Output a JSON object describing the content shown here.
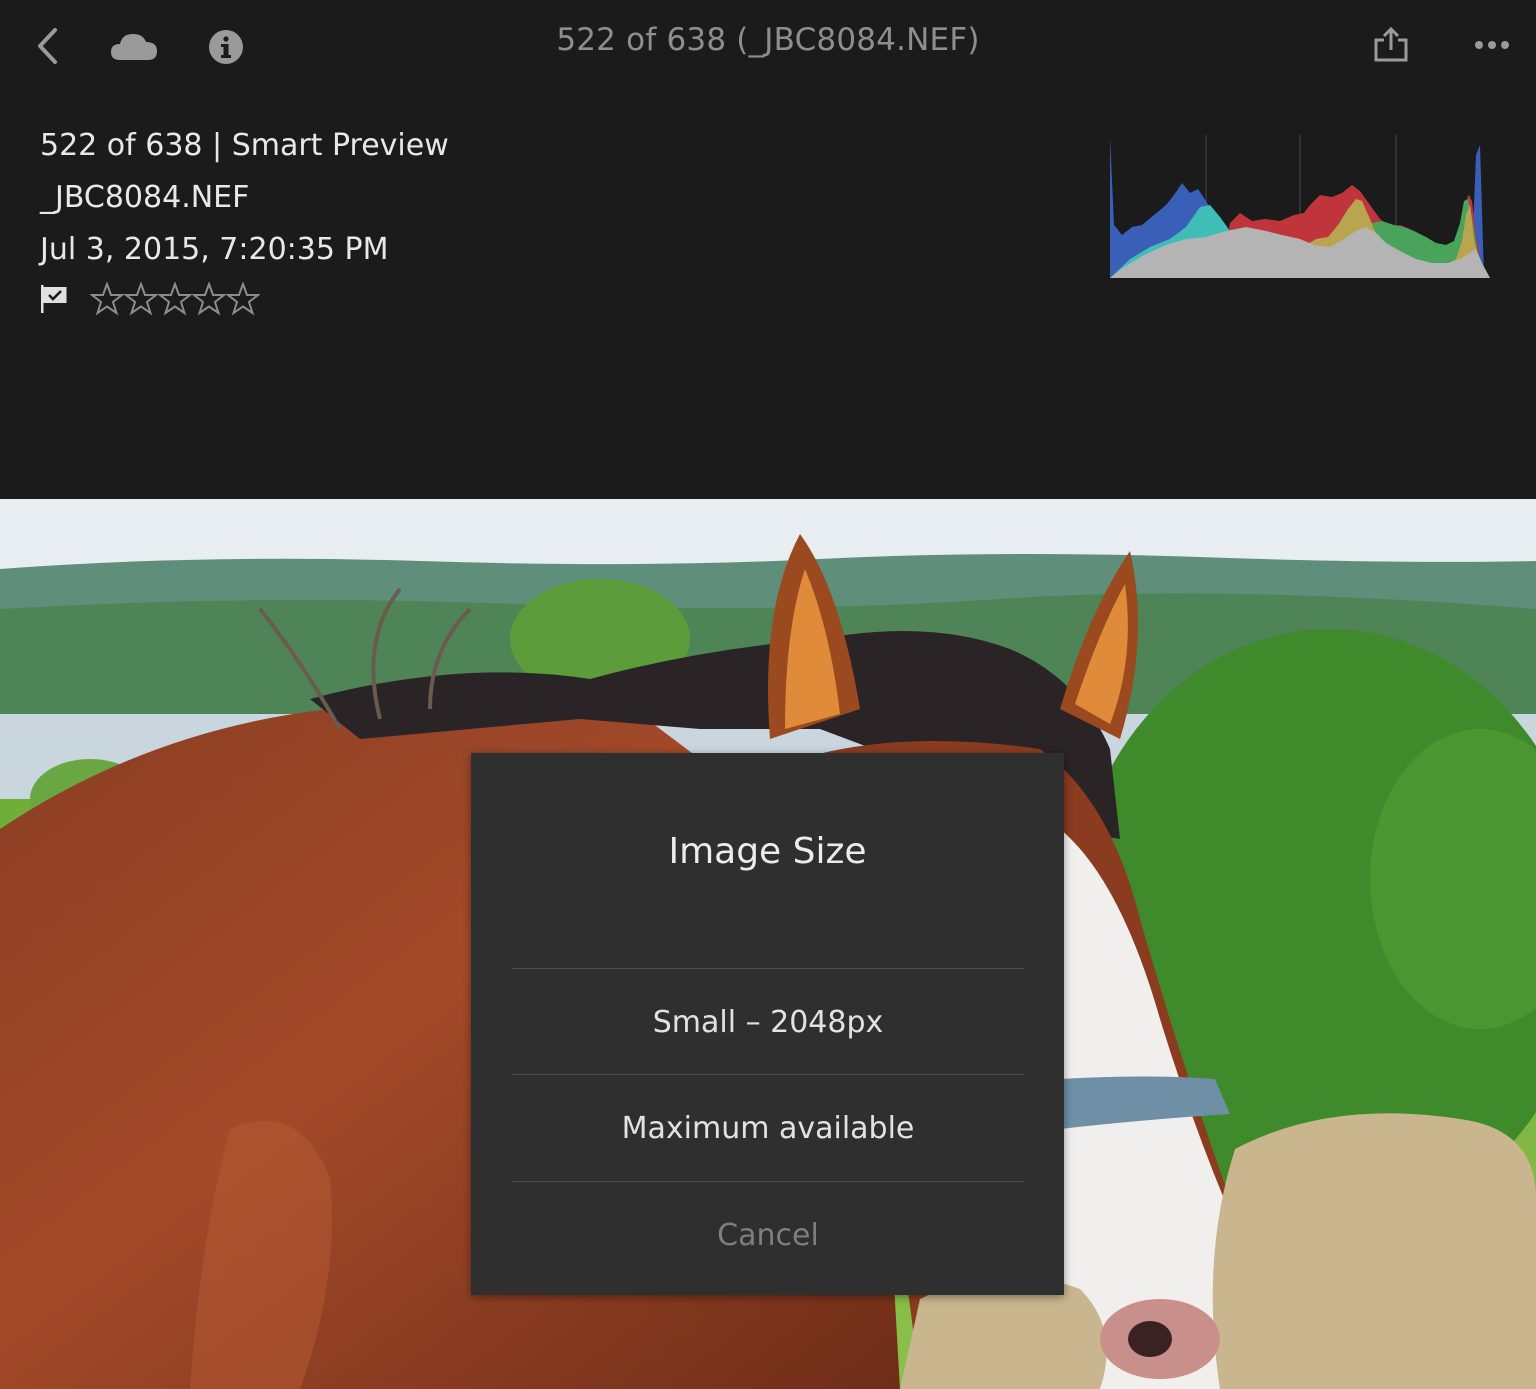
{
  "nav": {
    "title": "522 of 638 (_JBC8084.NEF)"
  },
  "info": {
    "line1": "522 of 638 | Smart Preview",
    "line2": "_JBC8084.NEF",
    "line3": "Jul 3, 2015, 7:20:35 PM"
  },
  "rating": {
    "value": 0,
    "max": 5
  },
  "icons": {
    "back": "back-chevron-icon",
    "cloud": "cloud-icon",
    "info": "info-icon",
    "share": "share-icon",
    "more": "more-icon",
    "flag": "flag-icon",
    "star": "star-outline-icon"
  },
  "colors": {
    "background": "#1b1b1b",
    "dialog": "#2f2f2f",
    "histogram_blue": "#3a5fb8",
    "histogram_cyan": "#3fbdb7",
    "histogram_red": "#c0343c",
    "histogram_yellow": "#b9a550",
    "histogram_green": "#4aa35a",
    "histogram_gray": "#b4b4b4"
  },
  "dialog": {
    "title": "Image Size",
    "options": [
      "Small – 2048px",
      "Maximum available"
    ],
    "cancel": "Cancel"
  }
}
